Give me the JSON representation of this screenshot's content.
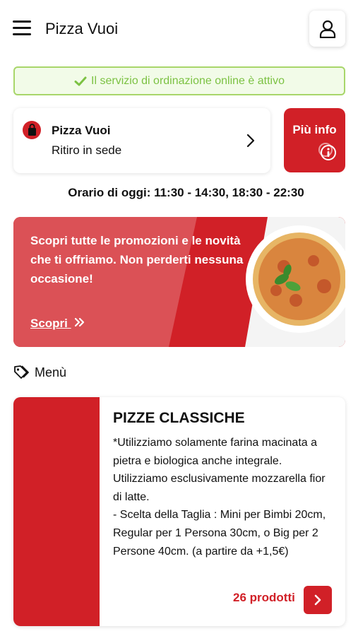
{
  "header": {
    "title": "Pizza Vuoi",
    "menu_icon": "hamburger-icon",
    "user_icon": "user-icon"
  },
  "status": {
    "text": "Il servizio di ordinazione online è attivo",
    "icon": "check-icon",
    "color": "#7cc243"
  },
  "store": {
    "name": "Pizza Vuoi",
    "mode": "Ritiro in sede",
    "icon": "shopping-bag-icon"
  },
  "info_button": {
    "label": "Più info",
    "icon": "info-icon"
  },
  "hours": {
    "text": "Orario di oggi: 11:30 - 14:30, 18:30 - 22:30"
  },
  "promo": {
    "text": "Scopri tutte le promozioni e le novità che ti offriamo. Non perderti nessuna occasione!",
    "link_label": "Scopri",
    "link_icon": "double-chevron-right-icon"
  },
  "menu": {
    "label": "Menù",
    "icon": "tag-icon"
  },
  "categories": [
    {
      "title": "PIZZE CLASSICHE",
      "description": "*Utilizziamo solamente farina macinata a pietra e biologica anche integrale. Utilizziamo esclusivamente mozzarella fior di latte.\n- Scelta della Taglia : Mini per Bimbi 20cm, Regular per 1 Persona 30cm, o Big per 2 Persone 40cm. (a partire da +1,5€)",
      "count": "26 prodotti"
    }
  ],
  "colors": {
    "brand": "#d12027",
    "success": "#7cc243"
  }
}
